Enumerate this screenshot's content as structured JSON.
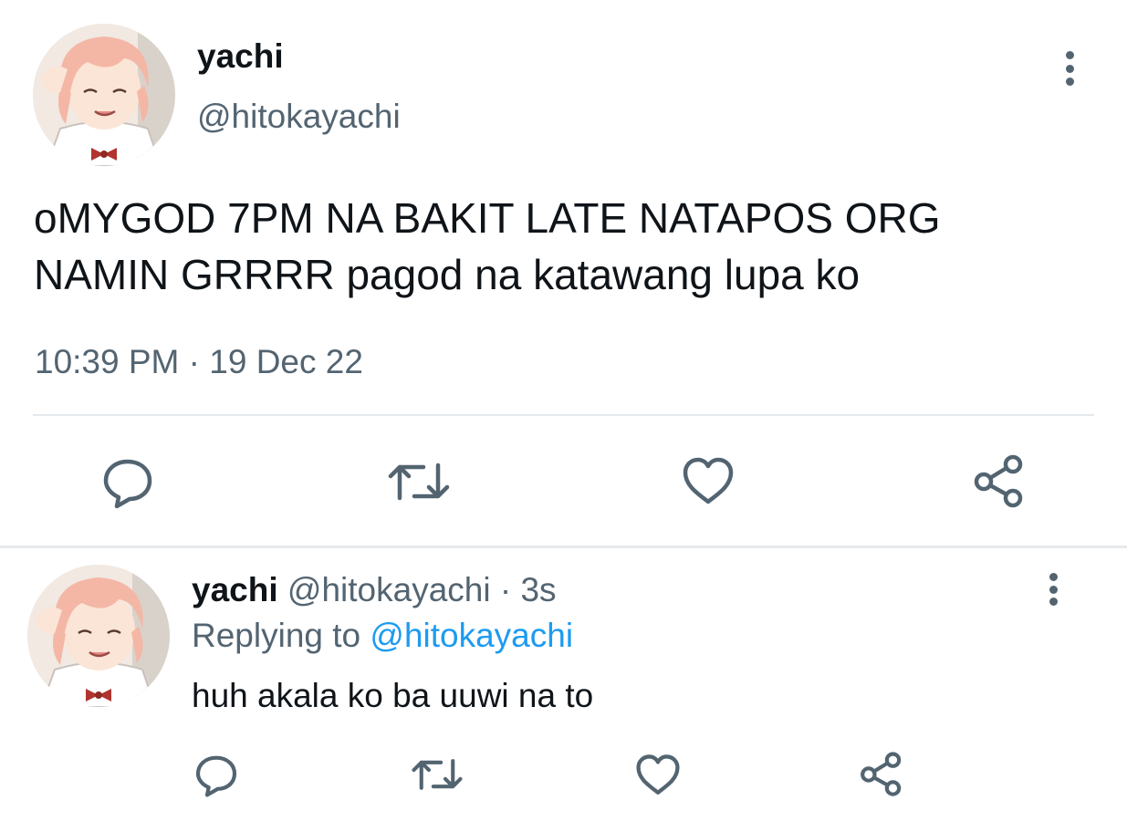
{
  "main_tweet": {
    "display_name": "yachi",
    "handle": "@hitokayachi",
    "text_line1": "oMYGOD 7PM NA BAKIT LATE NATAPOS ORG",
    "text_line2": "NAMIN GRRRR pagod na katawang lupa ko",
    "time": "10:39 PM",
    "separator": "·",
    "date": "19 Dec 22",
    "actions": [
      "reply-icon",
      "retweet-icon",
      "like-icon",
      "share-icon"
    ]
  },
  "reply_tweet": {
    "display_name": "yachi",
    "handle": "@hitokayachi",
    "dot_time": "· 3s",
    "replying_prefix": "Replying to",
    "replying_handle": "@hitokayachi",
    "text": "huh akala ko ba uuwi na to",
    "actions": [
      "reply-icon",
      "retweet-icon",
      "like-icon",
      "share-icon"
    ]
  },
  "colors": {
    "text_primary": "#0f1419",
    "text_secondary": "#536471",
    "link": "#1d9bf0",
    "divider": "#e6e9ec"
  }
}
